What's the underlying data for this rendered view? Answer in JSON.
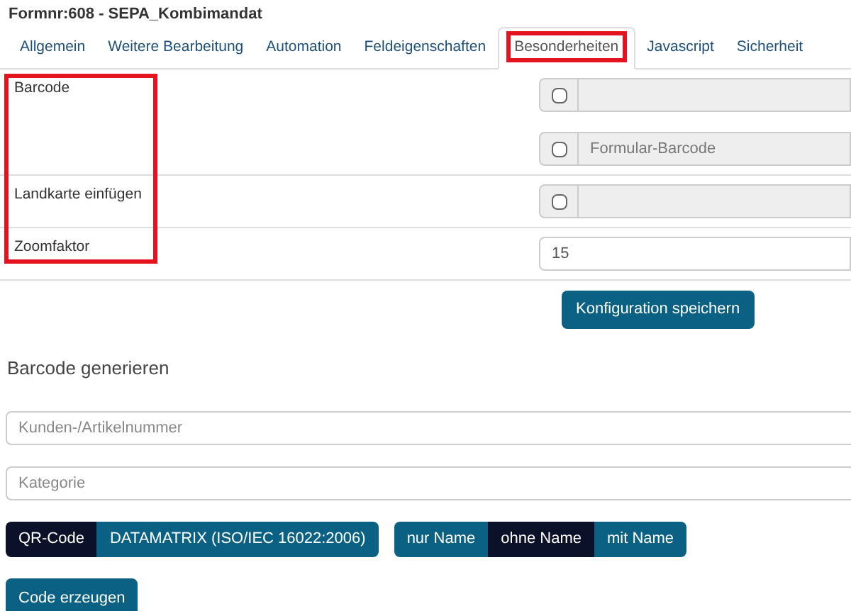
{
  "title": "Formnr:608 - SEPA_Kombimandat",
  "tabs": [
    {
      "label": "Allgemein",
      "selected": false,
      "highlighted": false
    },
    {
      "label": "Weitere Bearbeitung",
      "selected": false,
      "highlighted": false
    },
    {
      "label": "Automation",
      "selected": false,
      "highlighted": false
    },
    {
      "label": "Feldeigenschaften",
      "selected": false,
      "highlighted": false
    },
    {
      "label": "Besonderheiten",
      "selected": true,
      "highlighted": true
    },
    {
      "label": "Javascript",
      "selected": false,
      "highlighted": false
    },
    {
      "label": "Sicherheit",
      "selected": false,
      "highlighted": false
    }
  ],
  "labels_highlighted": true,
  "settings": [
    {
      "label": "Barcode",
      "fields": [
        {
          "kind": "checkbox",
          "checked": false
        },
        {
          "kind": "checkbox",
          "checked": false,
          "placeholder": "Formular-Barcode"
        }
      ]
    },
    {
      "label": "Landkarte einfügen",
      "fields": [
        {
          "kind": "checkbox",
          "checked": false
        }
      ]
    },
    {
      "label": "Zoomfaktor",
      "fields": [
        {
          "kind": "text",
          "value": "15"
        }
      ]
    }
  ],
  "save_button": "Konfiguration speichern",
  "generator": {
    "heading": "Barcode generieren",
    "fields": [
      {
        "placeholder": "Kunden-/Artikelnummer"
      },
      {
        "placeholder": "Kategorie"
      }
    ],
    "toggle_groups": [
      [
        {
          "label": "QR-Code",
          "selected": true
        },
        {
          "label": "DATAMATRIX (ISO/IEC 16022:2006)",
          "selected": false
        }
      ],
      [
        {
          "label": "nur Name",
          "selected": false
        },
        {
          "label": "ohne Name",
          "selected": true
        },
        {
          "label": "mit Name",
          "selected": false
        }
      ]
    ],
    "button": "Code erzeugen"
  }
}
